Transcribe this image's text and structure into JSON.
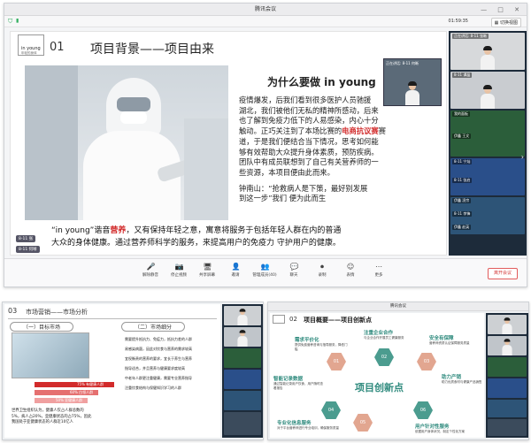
{
  "main": {
    "window_title": "腾讯会议",
    "top_right_time": "01:59:35",
    "top_right_layout": "切换视图",
    "slide": {
      "logo_line1": "in young",
      "logo_line2": "年轻的身体",
      "section_num": "01",
      "section_title": "项目背景——项目由来",
      "question": "为什么要做 in young",
      "para1": [
        "疫情爆发，后我们看到很多医护人员驰援",
        "湖北，我们被他们无私的精神所感动，后来",
        "也了解到免疫力低下的人易感染，内心十分",
        "触动。正巧关注到了本场比赛的电商抗议赛",
        "道，于是我们便结合当下情况，思考如何能",
        "够有效帮助大众提升身体素质，预防疾病。",
        "团队中有成员联想到了自己有关营养师的一",
        "些资源，本项目便由此而来。"
      ],
      "para1_highlight": "电商抗议赛",
      "quote": [
        "钟南山：“抢救病人是下策，最好别发展",
        "到这一步”我们 便为此而生"
      ],
      "bottom_a": "“in young”谐音",
      "bottom_hl": "营养",
      "bottom_b": "，又有保持年轻之意，寓意将服务于包括年轻人群在内的普通",
      "bottom_line2": "大众的身体健康。通过营养师科学的服务，来提高用户的免疫力 守护用户的健康。"
    },
    "speaker_tag1": "正在讲话: 8-11 何晰",
    "speaker_tag2": "8-11 何晰",
    "self_tag": "8-11 张",
    "thumbs": [
      "正在讲话: 8-11 张晰",
      "8-11 谭晶",
      "我的面板",
      "伊鑫 王文",
      "8-11 宁灿",
      "8-11 张启",
      "伊鑫 凌宗",
      "8-11 李锋",
      "伊鑫 赵英"
    ],
    "toolbar": [
      {
        "label": "解除静音",
        "icon": "🎤"
      },
      {
        "label": "停止视频",
        "icon": "📷"
      },
      {
        "label": "共享屏幕",
        "icon": "🖥"
      },
      {
        "label": "邀请",
        "icon": "👤"
      },
      {
        "label": "管理成员(40)",
        "icon": "👥"
      },
      {
        "label": "聊天",
        "icon": "💬"
      },
      {
        "label": "录制",
        "icon": "⏺"
      },
      {
        "label": "表情",
        "icon": "☺"
      },
      {
        "label": "更多",
        "icon": "⋯"
      }
    ],
    "leave_label": "离开会议"
  },
  "left": {
    "num": "03",
    "title": "市场营销——市场分析",
    "sub1": "（一）目标市场",
    "sub2": "（二）市场细分",
    "bar_labels": [
      "75% 有健康人群",
      "60% 白领人群",
      "50% 亚健康人群"
    ],
    "bullets": [
      "需要提升抵抗力、免疫力，抵抗力差的人群",
      "易感染病菌，因此对饮食与营养的需求较高",
      "宜权衡贵的营养的要求，宜长于养生与营养",
      "指导适合，并且营养与健康要求度较高",
      "中老年人群更注重健康，需要专业营养指导",
      "注重饮食结构与保健知识学习的人群"
    ],
    "foot_text": [
      "世界卫生组织认为，健康人仅占人群总数的",
      "5%，病人占20%，亚健康状态的占75%，因此",
      "我国处于亚健康状态的人群近10亿人"
    ]
  },
  "right": {
    "num": "02",
    "title": "项目概要——项目创新点",
    "center": "项目创新点",
    "items": [
      {
        "h": "需求平价化",
        "t": "提供免费营养咨询与指导服务，降低门槛"
      },
      {
        "h": "注重企业合作",
        "t": "与企业合作开展员工健康服务"
      },
      {
        "h": "安全有保障",
        "t": "营养师资质认证保障服务质量"
      },
      {
        "h": "智能记录数据",
        "t": "通过智能记录用户饮食，用户随时查看报告"
      },
      {
        "h": "助力产销",
        "t": "助力优质食材与健康产品销售"
      },
      {
        "h": "专业化信息服务",
        "t": "对于平台营养师进行专业培训，确保服务质量"
      },
      {
        "h": "用户针对性服务",
        "t": "依据用户身体状况，制定个性化方案"
      }
    ],
    "hex_nums": [
      "01",
      "02",
      "03",
      "04",
      "05",
      "06"
    ]
  },
  "colors": {
    "accent_red": "#d22b2b",
    "tencent_blue": "#2a7bf6",
    "thumb_bg": "#1d2b3a"
  }
}
